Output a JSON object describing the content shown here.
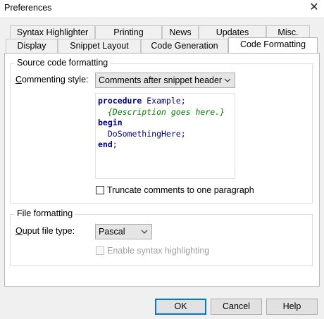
{
  "window": {
    "title": "Preferences",
    "close_glyph": "✕"
  },
  "tabs_row1": [
    "Syntax Highlighter",
    "Printing",
    "News",
    "Updates",
    "Misc."
  ],
  "tabs_row2": [
    "Display",
    "Snippet Layout",
    "Code Generation",
    "Code Formatting"
  ],
  "source_group": {
    "title": "Source code formatting",
    "commenting_label_ul": "C",
    "commenting_label_rest": "ommenting style:",
    "commenting_value": "Comments after snippet header",
    "code_lines": [
      [
        {
          "t": "procedure",
          "c": "kw"
        },
        {
          "t": " Example;",
          "c": "plain"
        }
      ],
      [
        {
          "t": "  {Description goes here.}",
          "c": "cmt"
        }
      ],
      [
        {
          "t": "begin",
          "c": "kw"
        }
      ],
      [
        {
          "t": "  DoSomethingHere;",
          "c": "plain"
        }
      ],
      [
        {
          "t": "end",
          "c": "kw"
        },
        {
          "t": ";",
          "c": "plain"
        }
      ]
    ],
    "truncate_label": "Truncate comments to one paragraph",
    "truncate_checked": false
  },
  "file_group": {
    "title": "File formatting",
    "output_label_ul": "O",
    "output_label_rest": "uput file type:",
    "output_value": "Pascal",
    "syntax_label": "Enable syntax highlighting",
    "syntax_checked": false,
    "syntax_enabled": false
  },
  "buttons": {
    "ok": "OK",
    "cancel": "Cancel",
    "help": "Help"
  }
}
